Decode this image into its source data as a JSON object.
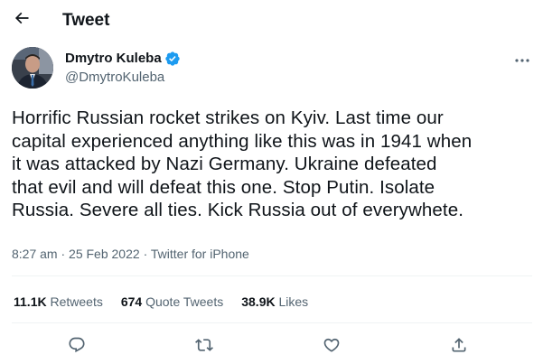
{
  "header": {
    "title": "Tweet",
    "back_icon": "arrow-left-icon"
  },
  "author": {
    "display_name": "Dmytro Kuleba",
    "handle": "@DmytroKuleba",
    "verified_icon": "verified-badge-icon",
    "more_icon": "more-horizontal-icon"
  },
  "tweet": {
    "lines": [
      "Horrific Russian rocket strikes on Kyiv. Last time our",
      "capital experienced anything like this was in 1941 when",
      "it was attacked by Nazi Germany. Ukraine defeated",
      "that evil and will defeat this one. Stop Putin. Isolate",
      "Russia. Severe all ties. Kick Russia out of everywhete."
    ],
    "time": "8:27 am",
    "separator": "·",
    "date": "25 Feb 2022",
    "source": "Twitter for iPhone"
  },
  "stats": {
    "retweets_count": "11.1K",
    "retweets_label": "Retweets",
    "quotes_count": "674",
    "quotes_label": "Quote Tweets",
    "likes_count": "38.9K",
    "likes_label": "Likes"
  },
  "actions": {
    "reply_icon": "reply-icon",
    "retweet_icon": "retweet-icon",
    "like_icon": "heart-icon",
    "share_icon": "share-icon"
  },
  "colors": {
    "text": "#0f1419",
    "secondary": "#536471",
    "verified": "#1d9bf0",
    "divider": "#eff3f4"
  }
}
